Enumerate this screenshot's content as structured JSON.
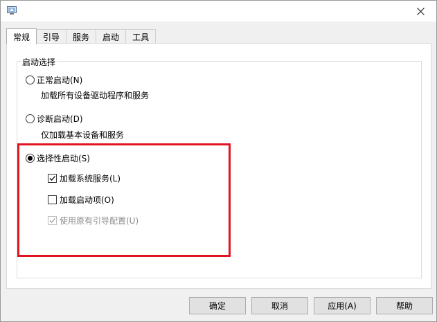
{
  "window": {
    "close_icon": "close-icon",
    "app_icon": "msconfig-icon"
  },
  "tabs": [
    {
      "label": "常规",
      "active": true
    },
    {
      "label": "引导",
      "active": false
    },
    {
      "label": "服务",
      "active": false
    },
    {
      "label": "启动",
      "active": false
    },
    {
      "label": "工具",
      "active": false
    }
  ],
  "startup_selection": {
    "legend": "启动选择",
    "normal": {
      "label": "正常启动(N)",
      "description": "加载所有设备驱动程序和服务",
      "selected": false
    },
    "diagnostic": {
      "label": "诊断启动(D)",
      "description": "仅加载基本设备和服务",
      "selected": false
    },
    "selective": {
      "label": "选择性启动(S)",
      "selected": true,
      "options": {
        "load_system_services": {
          "label": "加载系统服务(L)",
          "checked": true,
          "enabled": true
        },
        "load_startup_items": {
          "label": "加载启动项(O)",
          "checked": false,
          "enabled": true
        },
        "use_original_boot_config": {
          "label": "使用原有引导配置(U)",
          "checked": true,
          "enabled": false
        }
      }
    }
  },
  "highlight_color": "#e0141e",
  "buttons": {
    "ok": "确定",
    "cancel": "取消",
    "apply": "应用(A)",
    "help": "帮助"
  }
}
